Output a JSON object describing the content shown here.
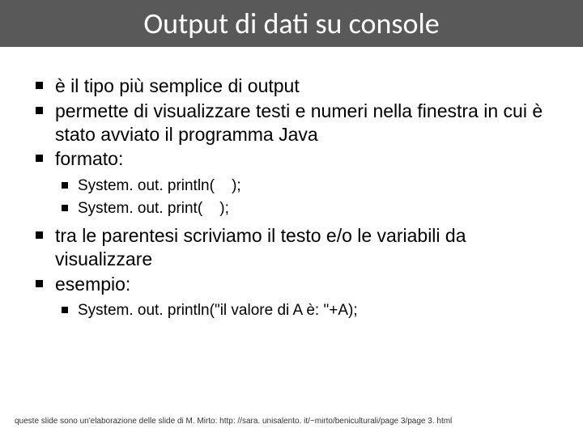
{
  "title": "Output di dati su console",
  "bullets": [
    {
      "text": "è il tipo più semplice di output"
    },
    {
      "text": "permette di visualizzare testi e numeri nella finestra in cui è stato avviato il programma Java"
    },
    {
      "text": "formato:",
      "sub": [
        "System. out. println(    );",
        "System. out. print(    );"
      ]
    },
    {
      "text": "tra le parentesi scriviamo il testo e/o le variabili da visualizzare"
    },
    {
      "text": "esempio:",
      "sub": [
        "System. out. println(\"il valore di A è: \"+A);"
      ]
    }
  ],
  "footer": "queste slide sono un'elaborazione delle slide di M. Mirto: http: //sara. unisalento. it/~mirto/beniculturali/page 3/page 3. html"
}
